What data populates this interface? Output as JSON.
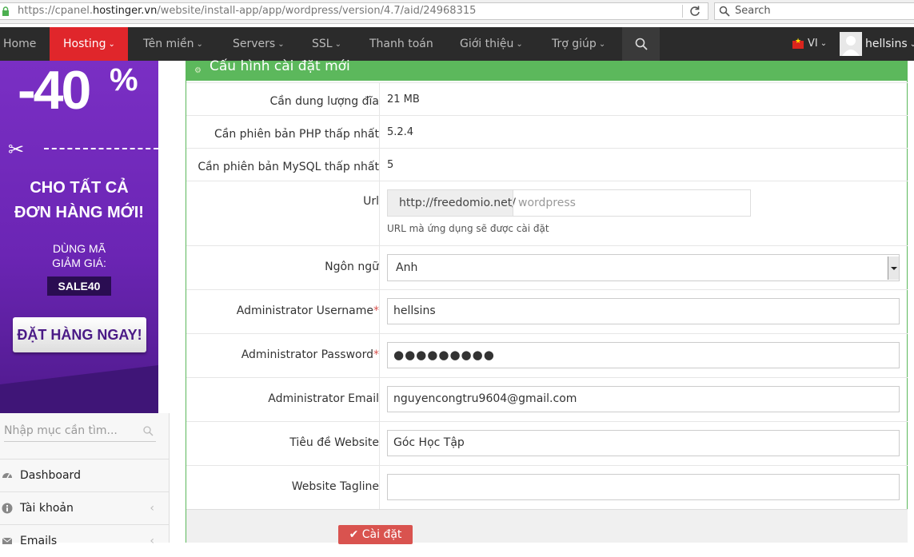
{
  "browser": {
    "url_prefix": "https://cpanel.",
    "url_domain": "hostinger.vn",
    "url_path": "/website/install-app/app/wordpress/version/4.7/aid/24968315",
    "search_placeholder": "Search"
  },
  "nav": {
    "home": "Home",
    "hosting": "Hosting",
    "domains": "Tên miền",
    "servers": "Servers",
    "ssl": "SSL",
    "billing": "Thanh toán",
    "about": "Giới thiệu",
    "help": "Trợ giúp",
    "language": "VI",
    "username": "hellsins",
    "chevron": "⌄"
  },
  "banner": {
    "discount": "-40",
    "percent": "%",
    "offer_line1": "CHO TẤT CẢ",
    "offer_line2": "ĐƠN HÀNG MỚI!",
    "code_label_line1": "DÙNG MÃ",
    "code_label_line2": "GIẢM GIÁ:",
    "code": "SALE40",
    "cta": "ĐẶT HÀNG NGAY!",
    "colors": {
      "primary": "#7a2fc4",
      "dark": "#3f1577"
    }
  },
  "sidebar": {
    "search_placeholder": "Nhập mục cần tìm...",
    "items": [
      {
        "label": "Dashboard",
        "icon": "dashboard-icon"
      },
      {
        "label": "Tài khoản",
        "icon": "info-icon",
        "arrow": "‹"
      },
      {
        "label": "Emails",
        "icon": "email-icon",
        "arrow": "‹"
      }
    ]
  },
  "form": {
    "title": "Cấu hình cài đặt mới",
    "disk_label": "Cần dung lượng đĩa",
    "disk_value": "21 MB",
    "php_label": "Cần phiên bản PHP thấp nhất",
    "php_value": "5.2.4",
    "mysql_label": "Cần phiên bản MySQL thấp nhất",
    "mysql_value": "5",
    "url_label": "Url",
    "url_prefix": "http://freedomio.net/",
    "url_placeholder": "wordpress",
    "url_help": "URL mà ứng dụng sẽ được cài đặt",
    "language_label": "Ngôn ngữ",
    "language_value": "Anh",
    "username_label": "Administrator Username",
    "username_value": "hellsins",
    "password_label": "Administrator Password",
    "password_value": "●●●●●●●●●",
    "email_label": "Administrator Email",
    "email_value": "nguyencongtru9604@gmail.com",
    "site_title_label": "Tiêu đề Website",
    "site_title_value": "Góc Học Tập",
    "tagline_label": "Website Tagline",
    "tagline_value": "",
    "required_mark": "*",
    "install_button": "Cài đặt",
    "colors": {
      "header": "#5cb85c",
      "button": "#d9534f"
    }
  }
}
